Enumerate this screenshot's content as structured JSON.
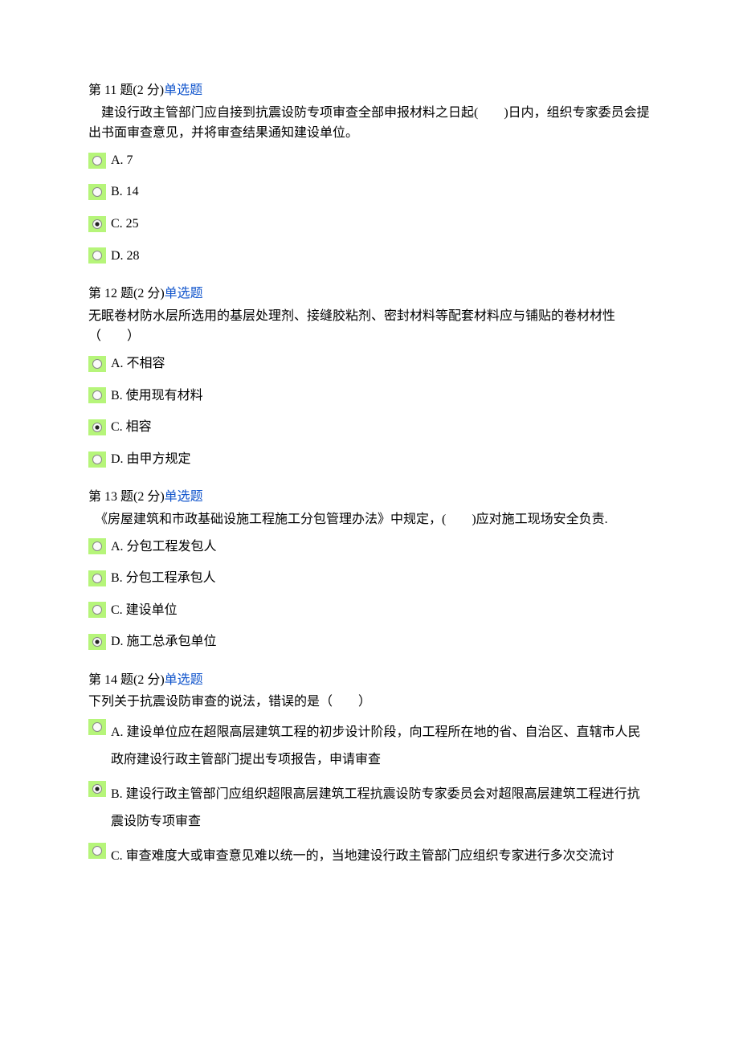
{
  "questions": [
    {
      "number": "第 11 题(2 分)",
      "type_label": "单选题",
      "body": "建设行政主管部门应自接到抗震设防专项审查全部申报材料之日起(　　)日内，组织专家委员会提出书面审查意见，并将审查结果通知建设单位。",
      "options": [
        {
          "label": "A. 7",
          "selected": false
        },
        {
          "label": "B. 14",
          "selected": false
        },
        {
          "label": "C. 25",
          "selected": true
        },
        {
          "label": "D. 28",
          "selected": false
        }
      ]
    },
    {
      "number": "第 12 题(2 分)",
      "type_label": "单选题",
      "body": "无眠卷材防水层所选用的基层处理剂、接缝胶粘剂、密封材料等配套材料应与铺贴的卷材材性（　　）",
      "options": [
        {
          "label": "A. 不相容",
          "selected": false
        },
        {
          "label": "B. 使用现有材料",
          "selected": false
        },
        {
          "label": "C. 相容",
          "selected": true
        },
        {
          "label": "D. 由甲方规定",
          "selected": false
        }
      ]
    },
    {
      "number": "第 13 题(2 分)",
      "type_label": "单选题",
      "body": "《房屋建筑和市政基础设施工程施工分包管理办法》中规定，(　　)应对施工现场安全负责.",
      "options": [
        {
          "label": "A. 分包工程发包人",
          "selected": false
        },
        {
          "label": "B. 分包工程承包人",
          "selected": false
        },
        {
          "label": "C. 建设单位",
          "selected": false
        },
        {
          "label": "D. 施工总承包单位",
          "selected": true
        }
      ]
    },
    {
      "number": "第 14 题(2 分)",
      "type_label": "单选题",
      "body": "下列关于抗震设防审查的说法，错误的是（　　）",
      "options": [
        {
          "label": "A. 建设单位应在超限高层建筑工程的初步设计阶段，向工程所在地的省、自治区、直辖市人民政府建设行政主管部门提出专项报告，申请审查",
          "selected": false,
          "wrap": true
        },
        {
          "label": "B. 建设行政主管部门应组织超限高层建筑工程抗震设防专家委员会对超限高层建筑工程进行抗震设防专项审查",
          "selected": true,
          "wrap": true
        },
        {
          "label": "C. 审查难度大或审查意见难以统一的，当地建设行政主管部门应组织专家进行多次交流讨",
          "selected": false,
          "wrap": true
        }
      ]
    }
  ]
}
